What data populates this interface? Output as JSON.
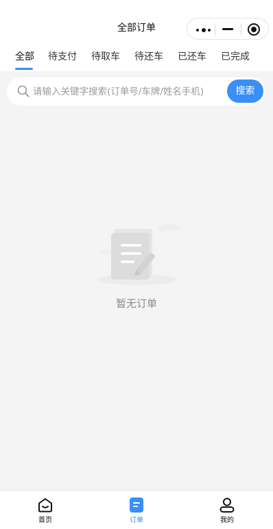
{
  "header": {
    "title": "全部订单",
    "capsule": {
      "more_icon": "more-dots-icon",
      "minimize_icon": "minimize-icon",
      "close_icon": "target-close-icon"
    }
  },
  "tabs": [
    {
      "label": "全部",
      "active": true
    },
    {
      "label": "待支付",
      "active": false
    },
    {
      "label": "待取车",
      "active": false
    },
    {
      "label": "待还车",
      "active": false
    },
    {
      "label": "已还车",
      "active": false
    },
    {
      "label": "已完成",
      "active": false
    }
  ],
  "search": {
    "placeholder": "请输入关键字搜索(订单号/车牌/姓名手机)",
    "value": "",
    "button_label": "搜索",
    "icon": "search-icon"
  },
  "empty_state": {
    "text": "暂无订单",
    "illustration": "document-pencil-illustration"
  },
  "tabbar": [
    {
      "label": "首页",
      "icon": "home-icon",
      "active": false
    },
    {
      "label": "订单",
      "icon": "order-document-icon",
      "active": true
    },
    {
      "label": "我的",
      "icon": "user-icon",
      "active": false
    }
  ],
  "colors": {
    "accent": "#3a8ef6",
    "page_background": "#f4f4f4",
    "empty_text": "#8a8a8a"
  }
}
